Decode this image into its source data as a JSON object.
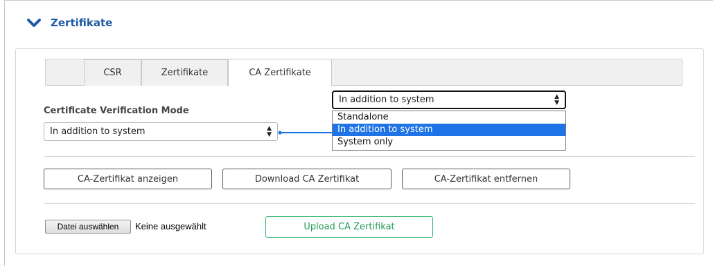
{
  "section": {
    "title": "Zertifikate",
    "toggle_icon": "chevron-down-icon",
    "accent_color": "#1f5aa6"
  },
  "tabs": [
    {
      "label": "CSR",
      "active": false
    },
    {
      "label": "Zertifikate",
      "active": false
    },
    {
      "label": "CA Zertifikate",
      "active": true
    }
  ],
  "verification_mode": {
    "label": "Certificate Verification Mode",
    "selected": "In addition to system",
    "options": [
      "Standalone",
      "In addition to system",
      "System only"
    ],
    "highlighted_option": "In addition to system",
    "highlight_color": "#1e73e6"
  },
  "buttons": {
    "show_ca": "CA-Zertifikat anzeigen",
    "download_ca": "Download CA Zertifikat",
    "remove_ca": "CA-Zertifikat entfernen",
    "upload_ca": "Upload CA Zertifikat"
  },
  "file_input": {
    "button_label": "Datei auswählen",
    "status": "Keine ausgewählt"
  },
  "colors": {
    "upload_accent": "#2db36b",
    "connector": "#1e73e6"
  }
}
